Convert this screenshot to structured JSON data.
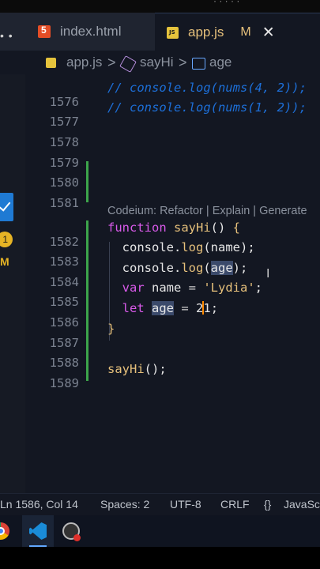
{
  "tabs": [
    {
      "label": "index.html",
      "icon": "html5-icon",
      "active": false
    },
    {
      "label": "app.js",
      "icon": "javascript-file-icon",
      "active": true,
      "modified_flag": "M",
      "close": "✕"
    }
  ],
  "breadcrumb": {
    "file": "app.js",
    "function": "sayHi",
    "variable": "age",
    "separator": ">"
  },
  "codelens": "Codeium: Refactor | Explain | Generate",
  "lines": [
    {
      "n": "1576",
      "text": "// console.log(nums(4, 2));"
    },
    {
      "n": "1577",
      "text": "// console.log(nums(1, 2));"
    },
    {
      "n": "1578",
      "text": ""
    },
    {
      "n": "1579",
      "text": ""
    },
    {
      "n": "1580",
      "text": ""
    },
    {
      "n": "1581",
      "text": ""
    },
    {
      "n": "1582",
      "text": "function sayHi() {"
    },
    {
      "n": "1583",
      "text": "console.log(name);"
    },
    {
      "n": "1584",
      "text": "console.log(age);"
    },
    {
      "n": "1585",
      "text": "var name = 'Lydia';"
    },
    {
      "n": "1586",
      "text": "let age = 21;"
    },
    {
      "n": "1587",
      "text": "}"
    },
    {
      "n": "1588",
      "text": ""
    },
    {
      "n": "1589",
      "text": "sayHi();"
    }
  ],
  "status": {
    "position": "Ln 1586, Col 14",
    "spaces": "Spaces: 2",
    "encoding": "UTF-8",
    "eol": "CRLF",
    "language_icon": "{}",
    "language": "JavaSc"
  },
  "activity": {
    "badge": "1",
    "modified": "M"
  },
  "colors": {
    "editor_bg": "#131722",
    "tab_bar_bg": "#1f2430",
    "comment": "#1d6fd8",
    "keyword": "#d95aea",
    "function": "#e6c07b",
    "string": "#e6c07b",
    "gutter_added": "#3da54b",
    "cursor": "#ff8a00"
  }
}
